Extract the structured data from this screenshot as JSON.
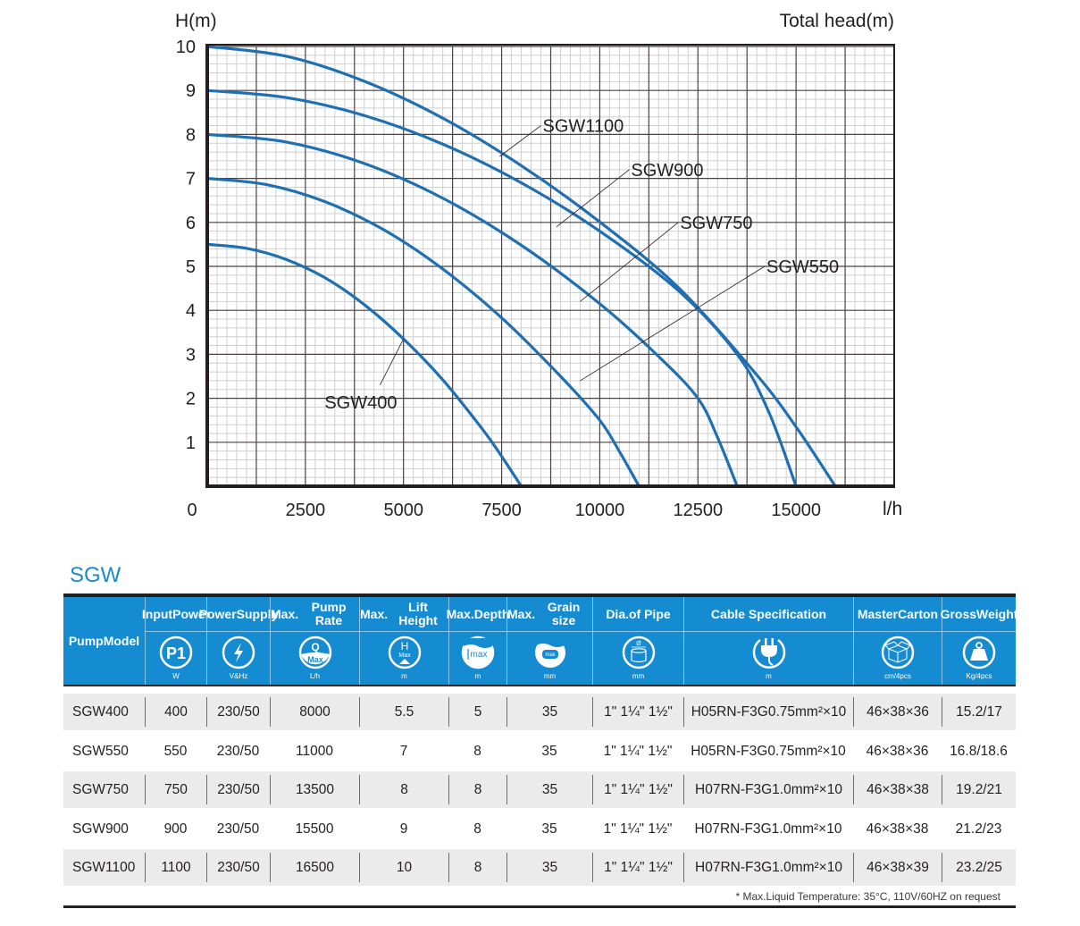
{
  "chart_data": {
    "type": "line",
    "title": "",
    "ylabel": "H(m)",
    "ylabel_right": "Total head(m)",
    "xlabel": "l/h",
    "xlim": [
      0,
      17500
    ],
    "ylim": [
      0,
      10
    ],
    "x_ticks": [
      "0",
      "2500",
      "5000",
      "7500",
      "10000",
      "12500",
      "15000"
    ],
    "x_tick_values": [
      0,
      2500,
      5000,
      7500,
      10000,
      12500,
      15000
    ],
    "y_ticks": [
      "1",
      "2",
      "3",
      "4",
      "5",
      "6",
      "7",
      "8",
      "9",
      "10"
    ],
    "y_tick_values": [
      1,
      2,
      3,
      4,
      5,
      6,
      7,
      8,
      9,
      10
    ],
    "grid": true,
    "major_grid_x_step": 1250,
    "major_grid_y_step": 1,
    "minor_divisions": 5,
    "line_color": "#1f6fb3",
    "series": [
      {
        "name": "SGW400",
        "label": "SGW400",
        "x": [
          0,
          1000,
          2000,
          3000,
          4000,
          5000,
          6000,
          7000,
          7500,
          8000
        ],
        "y": [
          5.5,
          5.41,
          5.16,
          4.74,
          4.13,
          3.35,
          2.42,
          1.31,
          0.68,
          0
        ],
        "label_anchor": [
          5000,
          3.35
        ],
        "label_pos": [
          4400,
          2.3
        ]
      },
      {
        "name": "SGW550",
        "label": "SGW550",
        "x": [
          0,
          1500,
          3000,
          4500,
          6000,
          7500,
          9000,
          10000,
          10500,
          11000
        ],
        "y": [
          7.0,
          6.86,
          6.47,
          5.83,
          4.94,
          3.83,
          2.5,
          1.5,
          0.79,
          0
        ],
        "label_anchor": [
          9500,
          2.4
        ],
        "label_pos": [
          14200,
          5.0
        ]
      },
      {
        "name": "SGW750",
        "label": "SGW750",
        "x": [
          0,
          2000,
          4000,
          6000,
          8000,
          10000,
          11500,
          12500,
          13000,
          13500
        ],
        "y": [
          8.0,
          7.83,
          7.34,
          6.55,
          5.48,
          4.15,
          2.95,
          2.0,
          1.11,
          0
        ],
        "label_anchor": [
          9500,
          4.2
        ],
        "label_pos": [
          12000,
          6.0
        ]
      },
      {
        "name": "SGW900",
        "label": "SGW900",
        "x": [
          0,
          2000,
          4000,
          6000,
          8000,
          10000,
          12000,
          13500,
          14300,
          15000
        ],
        "y": [
          9.0,
          8.84,
          8.43,
          7.78,
          6.9,
          5.8,
          4.45,
          3.0,
          1.7,
          0
        ],
        "label_anchor": [
          8900,
          5.9
        ],
        "label_pos": [
          10750,
          7.2
        ]
      },
      {
        "name": "SGW1100",
        "label": "SGW1100",
        "x": [
          0,
          2000,
          4000,
          6000,
          8000,
          10000,
          12000,
          14000,
          15000,
          16000
        ],
        "y": [
          10.0,
          9.78,
          9.21,
          8.37,
          7.29,
          6.01,
          4.52,
          2.53,
          1.35,
          0
        ],
        "label_anchor": [
          7450,
          7.5
        ],
        "label_pos": [
          8500,
          8.2
        ]
      }
    ]
  },
  "table": {
    "series_title": "SGW",
    "headers": [
      {
        "label": "Pump Model",
        "icon": null,
        "unit": ""
      },
      {
        "label": "Input Power",
        "icon": "p1-power-icon",
        "unit": "W"
      },
      {
        "label": "Power Supply",
        "icon": "lightning-icon",
        "unit": "V&Hz"
      },
      {
        "label": "Max. Pump Rate",
        "icon": "flow-rate-icon",
        "unit": "L/h"
      },
      {
        "label": "Max. Lift Height",
        "icon": "lift-height-icon",
        "unit": "m"
      },
      {
        "label": "Max. Depth",
        "icon": "depth-icon",
        "unit": "m"
      },
      {
        "label": "Max. Grain size",
        "icon": "grain-size-icon",
        "unit": "mm"
      },
      {
        "label": "Dia.of Pipe",
        "icon": "pipe-diameter-icon",
        "unit": "mm"
      },
      {
        "label": "Cable Specification",
        "icon": "plug-icon",
        "unit": "m"
      },
      {
        "label": "Master Carton",
        "icon": "carton-box-icon",
        "unit": "cm/4pcs"
      },
      {
        "label": "Gross Weight",
        "icon": "weight-icon",
        "unit": "Kg/4pcs"
      }
    ],
    "header_lines": [
      [
        "Pump",
        "Model"
      ],
      [
        "Input",
        "Power"
      ],
      [
        "Power",
        "Supply"
      ],
      [
        "Max.",
        "Pump Rate"
      ],
      [
        "Max.",
        "Lift Height"
      ],
      [
        "Max.",
        "Depth"
      ],
      [
        "Max.",
        "Grain size"
      ],
      [
        "Dia.of Pipe"
      ],
      [
        "Cable Specification"
      ],
      [
        "Master",
        "Carton"
      ],
      [
        "Gross",
        "Weight"
      ]
    ],
    "icon_text": {
      "p1": "P1",
      "q": "Q",
      "max": "Max",
      "h": "H",
      "depth_max": "max",
      "grain_max": "max",
      "dia": "Ø"
    },
    "rows": [
      [
        "SGW400",
        "400",
        "230/50",
        "8000",
        "5.5",
        "5",
        "35",
        "1\" 1¼\" 1½\"",
        "H05RN-F3G0.75mm²×10",
        "46×38×36",
        "15.2/17"
      ],
      [
        "SGW550",
        "550",
        "230/50",
        "11000",
        "7",
        "8",
        "35",
        "1\" 1¼\" 1½\"",
        "H05RN-F3G0.75mm²×10",
        "46×38×36",
        "16.8/18.6"
      ],
      [
        "SGW750",
        "750",
        "230/50",
        "13500",
        "8",
        "8",
        "35",
        "1\" 1¼\" 1½\"",
        "H07RN-F3G1.0mm²×10",
        "46×38×38",
        "19.2/21"
      ],
      [
        "SGW900",
        "900",
        "230/50",
        "15500",
        "9",
        "8",
        "35",
        "1\" 1¼\" 1½\"",
        "H07RN-F3G1.0mm²×10",
        "46×38×38",
        "21.2/23"
      ],
      [
        "SGW1100",
        "1100",
        "230/50",
        "16500",
        "10",
        "8",
        "35",
        "1\" 1¼\" 1½\"",
        "H07RN-F3G1.0mm²×10",
        "46×38×39",
        "23.2/25"
      ]
    ],
    "footnote": "* Max.Liquid Temperature: 35°C, 110V/60HZ on request",
    "colors": {
      "header_bg": "#158bd2",
      "title": "#1a8ad0",
      "row_grey": "#ebebeb"
    }
  }
}
